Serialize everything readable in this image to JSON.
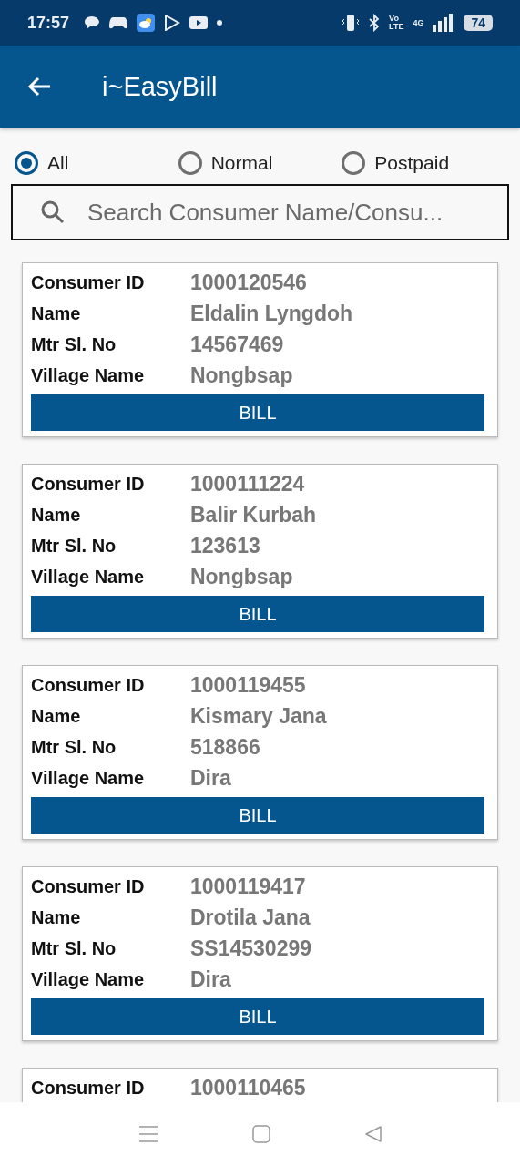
{
  "status_bar": {
    "time": "17:57",
    "volte_top": "Vo",
    "volte_bottom": "LTE",
    "network": "4G",
    "battery": "74"
  },
  "app_bar": {
    "title": "i~EasyBill"
  },
  "filters": [
    {
      "label": "All",
      "selected": true
    },
    {
      "label": "Normal",
      "selected": false
    },
    {
      "label": "Postpaid",
      "selected": false
    }
  ],
  "search": {
    "placeholder": "Search Consumer Name/Consu..."
  },
  "consumers": [
    {
      "fields": [
        {
          "label": "Consumer ID",
          "value": "1000120546"
        },
        {
          "label": "Name",
          "value": "Eldalin Lyngdoh"
        },
        {
          "label": "Mtr Sl. No",
          "value": "14567469"
        },
        {
          "label": "Village Name",
          "value": "Nongbsap"
        }
      ],
      "button": "BILL"
    },
    {
      "fields": [
        {
          "label": "Consumer ID",
          "value": "1000111224"
        },
        {
          "label": "Name",
          "value": "Balir Kurbah"
        },
        {
          "label": "Mtr Sl. No",
          "value": "123613"
        },
        {
          "label": "Village Name",
          "value": "Nongbsap"
        }
      ],
      "button": "BILL"
    },
    {
      "fields": [
        {
          "label": "Consumer ID",
          "value": "1000119455"
        },
        {
          "label": "Name",
          "value": "Kismary Jana"
        },
        {
          "label": "Mtr Sl. No",
          "value": "518866"
        },
        {
          "label": "Village Name",
          "value": "Dira"
        }
      ],
      "button": "BILL"
    },
    {
      "fields": [
        {
          "label": "Consumer ID",
          "value": "1000119417"
        },
        {
          "label": "Name",
          "value": "Drotila Jana"
        },
        {
          "label": "Mtr Sl. No",
          "value": "SS14530299"
        },
        {
          "label": "Village Name",
          "value": "Dira"
        }
      ],
      "button": "BILL"
    },
    {
      "fields": [
        {
          "label": "Consumer ID",
          "value": "1000110465"
        }
      ]
    }
  ]
}
